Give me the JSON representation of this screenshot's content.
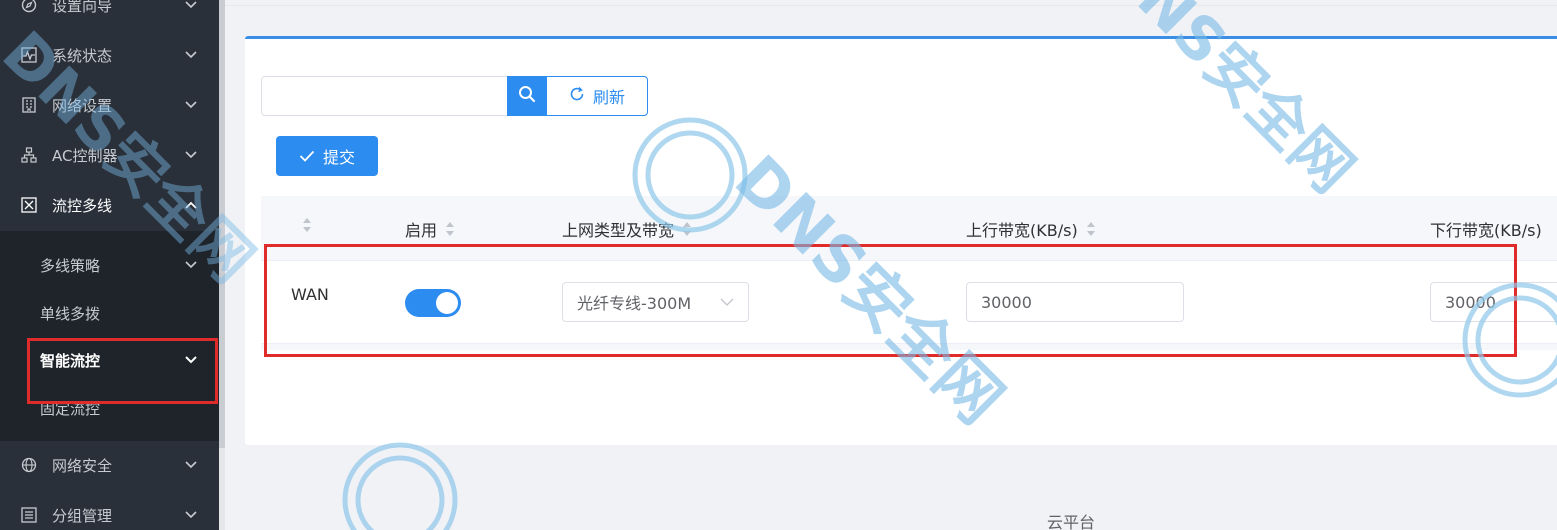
{
  "sidebar": {
    "items": [
      {
        "label": "设置向导",
        "icon": "compass-icon"
      },
      {
        "label": "系统状态",
        "icon": "pulse-icon"
      },
      {
        "label": "网络设置",
        "icon": "building-icon"
      },
      {
        "label": "AC控制器",
        "icon": "network-icon"
      },
      {
        "label": "流控多线",
        "icon": "grid-icon"
      },
      {
        "label": "网络安全",
        "icon": "globe-icon"
      },
      {
        "label": "分组管理",
        "icon": "list-icon"
      }
    ],
    "sub_items": [
      {
        "label": "多线策略"
      },
      {
        "label": "单线多拨"
      },
      {
        "label": "智能流控"
      },
      {
        "label": "固定流控"
      }
    ]
  },
  "toolbar": {
    "search_placeholder": "",
    "refresh_label": "刷新",
    "submit_label": "提交"
  },
  "table": {
    "headers": {
      "enable": "启用",
      "type": "上网类型及带宽",
      "up": "上行带宽(KB/s)",
      "down": "下行带宽(KB/s)"
    },
    "rows": [
      {
        "name": "WAN",
        "enabled": true,
        "type": "光纤专线-300M",
        "up": "30000",
        "down": "30000"
      }
    ]
  },
  "footer": {
    "text": "云平台"
  },
  "watermark": {
    "text": "DNS安全网"
  },
  "colors": {
    "primary": "#2d8cf0",
    "sidebar": "#2a3039",
    "highlight": "#e02b2b"
  }
}
